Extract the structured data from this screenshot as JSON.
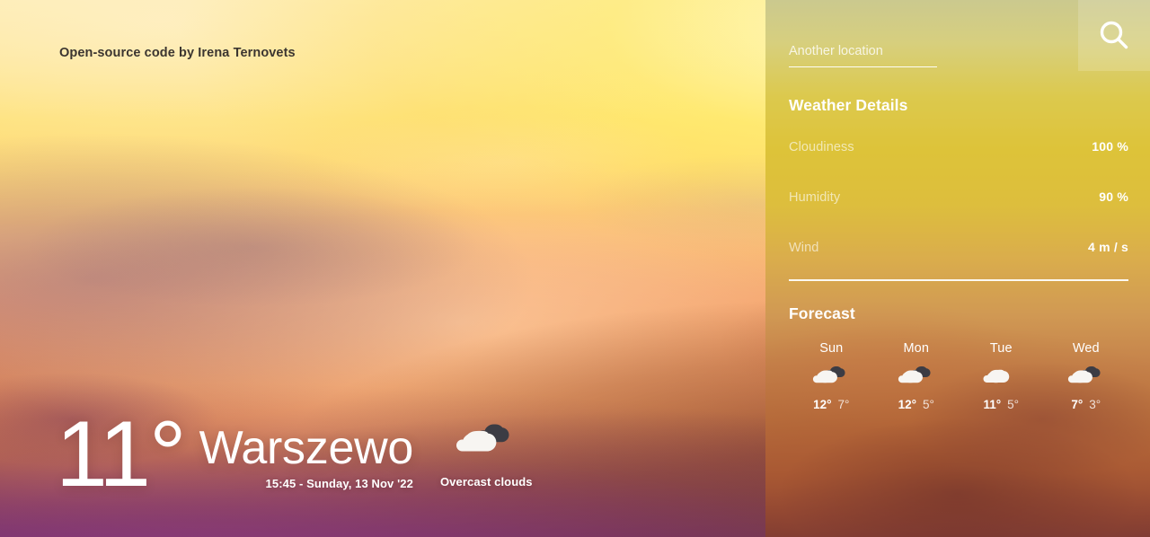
{
  "attribution": "Open-source code by Irena Ternovets",
  "current": {
    "temperature": "11°",
    "city": "Warszewo",
    "datetime": "15:45 - Sunday, 13 Nov '22",
    "condition": "Overcast clouds",
    "icon": "overcast-clouds-icon"
  },
  "panel": {
    "search": {
      "placeholder": "Another location",
      "value": "",
      "button_icon": "search-icon"
    },
    "details": {
      "heading": "Weather Details",
      "rows": [
        {
          "label": "Cloudiness",
          "value": "100 %"
        },
        {
          "label": "Humidity",
          "value": "90 %"
        },
        {
          "label": "Wind",
          "value": "4 m / s"
        }
      ]
    },
    "forecast": {
      "heading": "Forecast",
      "days": [
        {
          "day": "Sun",
          "icon": "overcast-clouds-icon",
          "high": "12°",
          "low": "7°"
        },
        {
          "day": "Mon",
          "icon": "overcast-clouds-icon",
          "high": "12°",
          "low": "5°"
        },
        {
          "day": "Tue",
          "icon": "cloud-icon",
          "high": "11°",
          "low": "5°"
        },
        {
          "day": "Wed",
          "icon": "overcast-clouds-icon",
          "high": "7°",
          "low": "3°"
        }
      ]
    }
  },
  "colors": {
    "text_light": "#ffffff",
    "attribution_text": "#3b3530",
    "cloud_front": "#f7f5f2",
    "cloud_back": "#3c3c44"
  }
}
